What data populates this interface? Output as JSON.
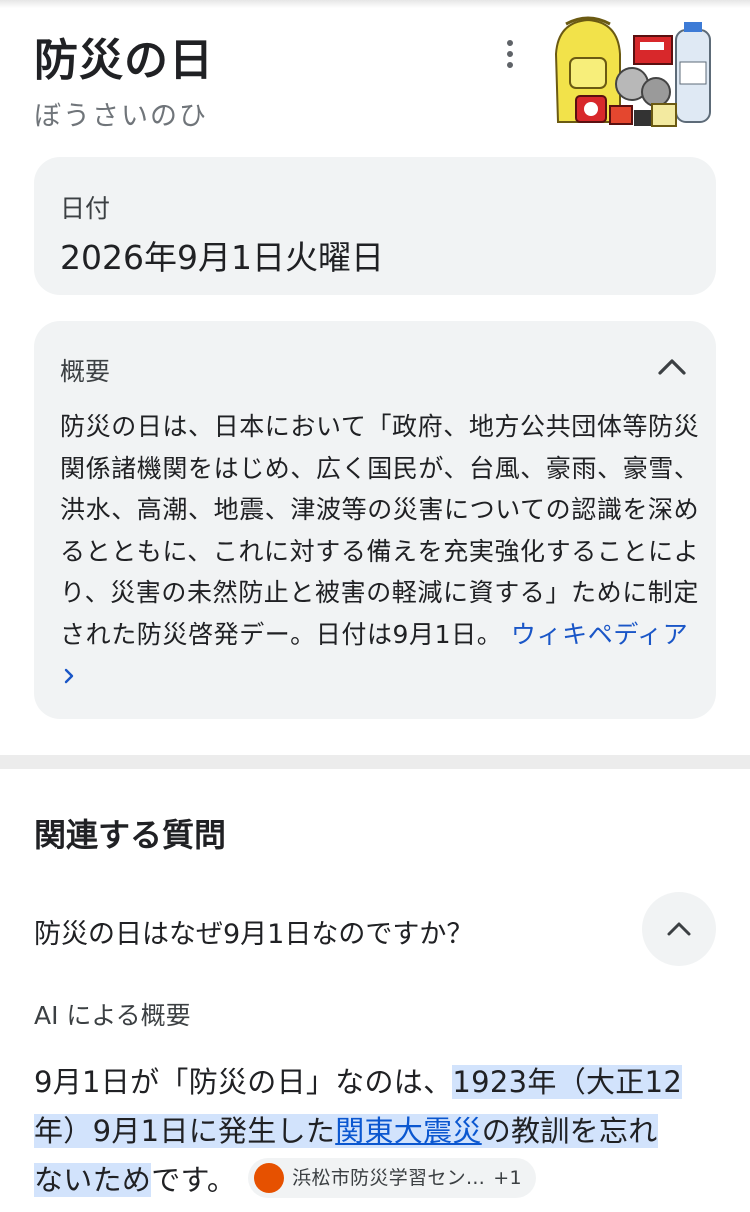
{
  "header": {
    "title": "防災の日",
    "reading": "ぼうさいのひ"
  },
  "date_card": {
    "label": "日付",
    "value": "2026年9月1日火曜日"
  },
  "summary_card": {
    "label": "概要",
    "text": "防災の日は、日本において「政府、地方公共団体等防災関係諸機関をはじめ、広く国民が、台風、豪雨、豪雪、洪水、高潮、地震、津波等の災害についての認識を深めるとともに、これに対する備えを充実強化することにより、災害の未然防止と被害の軽減に資する」ために制定された防災啓発デー。日付は9月1日。",
    "link_label": "ウィキペディア"
  },
  "related_questions": {
    "heading": "関連する質問",
    "question": "防災の日はなぜ9月1日なのですか？",
    "ai_label": "AI による概要",
    "answer_part1": "9月1日が「防災の日」なのは、",
    "answer_hl1": "1923年（大正12年）9月1日に発生した",
    "answer_link": "関東大震災",
    "answer_part2": "の教訓を忘れ",
    "answer_hl2": "ないため",
    "answer_part3": "です。",
    "source_name": "浜松市防災学習セン…",
    "source_more": "+1"
  },
  "colors": {
    "link": "#1a56c7",
    "highlight": "#d2e3fc",
    "card_bg": "#f1f3f4",
    "source_icon": "#e65100"
  },
  "icons": {
    "more": "more-vert-icon",
    "collapse": "chevron-up-icon",
    "link_arrow": "chevron-right-icon"
  }
}
